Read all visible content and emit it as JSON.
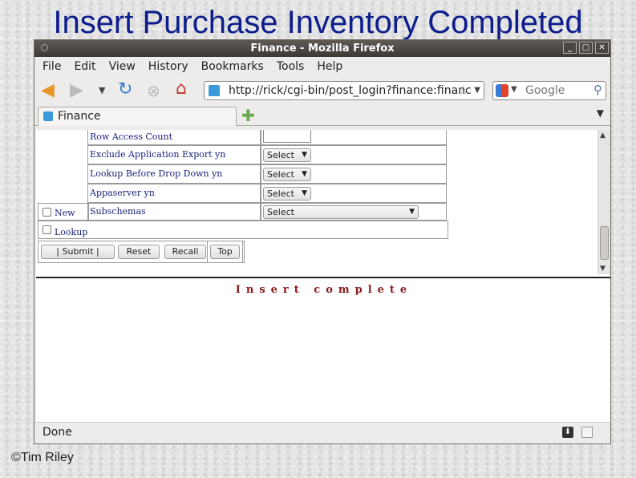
{
  "slide": {
    "title": "Insert Purchase Inventory Completed",
    "copyright": "©Tim Riley"
  },
  "window": {
    "title": "Finance - Mozilla Firefox",
    "controls": [
      "_",
      "□",
      "✕"
    ]
  },
  "menu": [
    "File",
    "Edit",
    "View",
    "History",
    "Bookmarks",
    "Tools",
    "Help"
  ],
  "nav": {
    "url": "http://rick/cgi-bin/post_login?finance:financ",
    "search_placeholder": "Google"
  },
  "tabs": [
    {
      "label": "Finance"
    }
  ],
  "form": {
    "rows": [
      {
        "label": "Row Access Count",
        "control": "text"
      },
      {
        "label": "Exclude Application Export yn",
        "control": "select",
        "value": "Select"
      },
      {
        "label": "Lookup Before Drop Down yn",
        "control": "select",
        "value": "Select"
      },
      {
        "label": "Appaserver yn",
        "control": "select",
        "value": "Select"
      },
      {
        "label": "Subschemas",
        "control": "select-wide",
        "value": "Select"
      }
    ],
    "checkboxes": [
      {
        "label": "New",
        "checked": false
      },
      {
        "label": "Lookup",
        "checked": false
      }
    ],
    "buttons": {
      "submit": "|   Submit   |",
      "reset": "Reset",
      "recall": "Recall",
      "top": "Top"
    }
  },
  "message": "Insert complete",
  "status": "Done"
}
